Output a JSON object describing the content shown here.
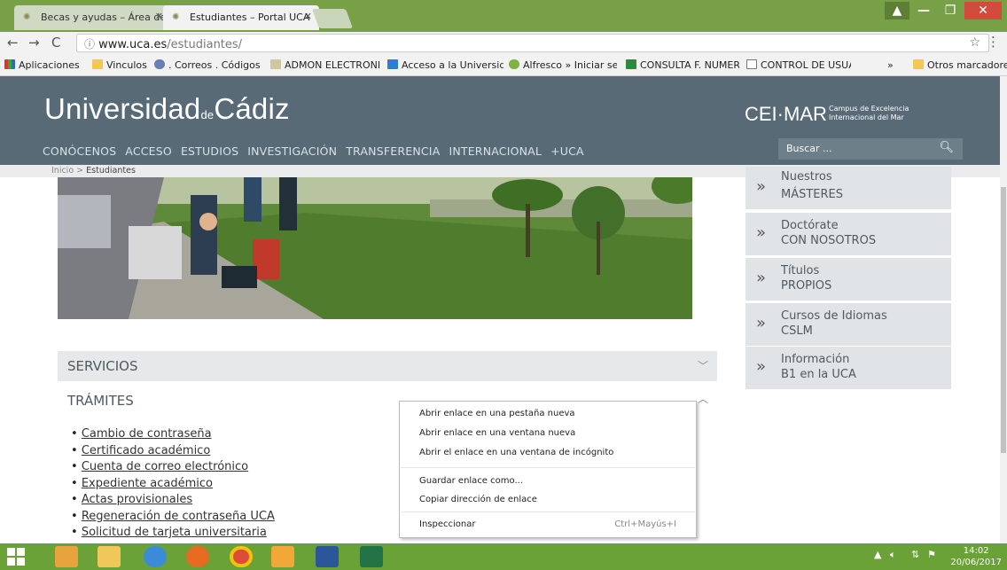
{
  "browser": {
    "tabs": [
      {
        "title": "Becas y ayudas – Área de"
      },
      {
        "title": "Estudiantes – Portal UCA"
      }
    ],
    "url_host": "www.uca.es",
    "url_path": "/estudiantes/",
    "bookmarks": [
      "Aplicaciones",
      "Vinculos",
      ". Correos . Códigos pc",
      "ADMON ELECTRONIC",
      "Acceso a la Universida",
      "Alfresco » Iniciar sesió",
      "CONSULTA F. NUMER",
      "CONTROL DE USUAR",
      "»",
      "Otros marcadores"
    ]
  },
  "site": {
    "logo_part1": "Universidad",
    "logo_part2": "de",
    "logo_part3": "Cádiz",
    "ceimar": "CEI·MAR",
    "ceimar_sub1": "Campus de Excelencia",
    "ceimar_sub2": "Internacional del Mar",
    "nav": [
      "CONÓCENOS",
      "ACCESO",
      "ESTUDIOS",
      "INVESTIGACIÓN",
      "TRANSFERENCIA",
      "INTERNACIONAL",
      "+UCA"
    ],
    "search_placeholder": "Buscar ..."
  },
  "breadcrumb": {
    "home": "Inicio",
    "sep": ">",
    "current": "Estudiantes"
  },
  "right_menu": [
    {
      "l1": "Nuestros",
      "l2": "MÁSTERES"
    },
    {
      "l1": "Doctórate",
      "l2": "CON NOSOTROS"
    },
    {
      "l1": "Títulos",
      "l2": "PROPIOS"
    },
    {
      "l1": "Cursos de Idiomas",
      "l2": "CSLM"
    },
    {
      "l1": "Información",
      "l2": "B1 en la UCA"
    }
  ],
  "accordion": {
    "servicios": "SERVICIOS",
    "tramites": "TRÁMITES"
  },
  "tramites_links": [
    "Cambio de contraseña",
    "Certificado académico",
    "Cuenta de correo electrónico",
    "Expediente académico",
    "Actas provisionales",
    "Regeneración de contraseña UCA",
    "Solicitud de tarjeta universitaria"
  ],
  "context_menu": {
    "open_tab": "Abrir enlace en una pestaña nueva",
    "open_window": "Abrir enlace en una ventana nueva",
    "open_incognito": "Abrir el enlace en una ventana de incógnito",
    "save_link": "Guardar enlace como...",
    "copy_link": "Copiar dirección de enlace",
    "inspect": "Inspeccionar",
    "inspect_shortcut": "Ctrl+Mayús+I"
  },
  "taskbar": {
    "time": "14:02",
    "date": "20/06/2017"
  }
}
